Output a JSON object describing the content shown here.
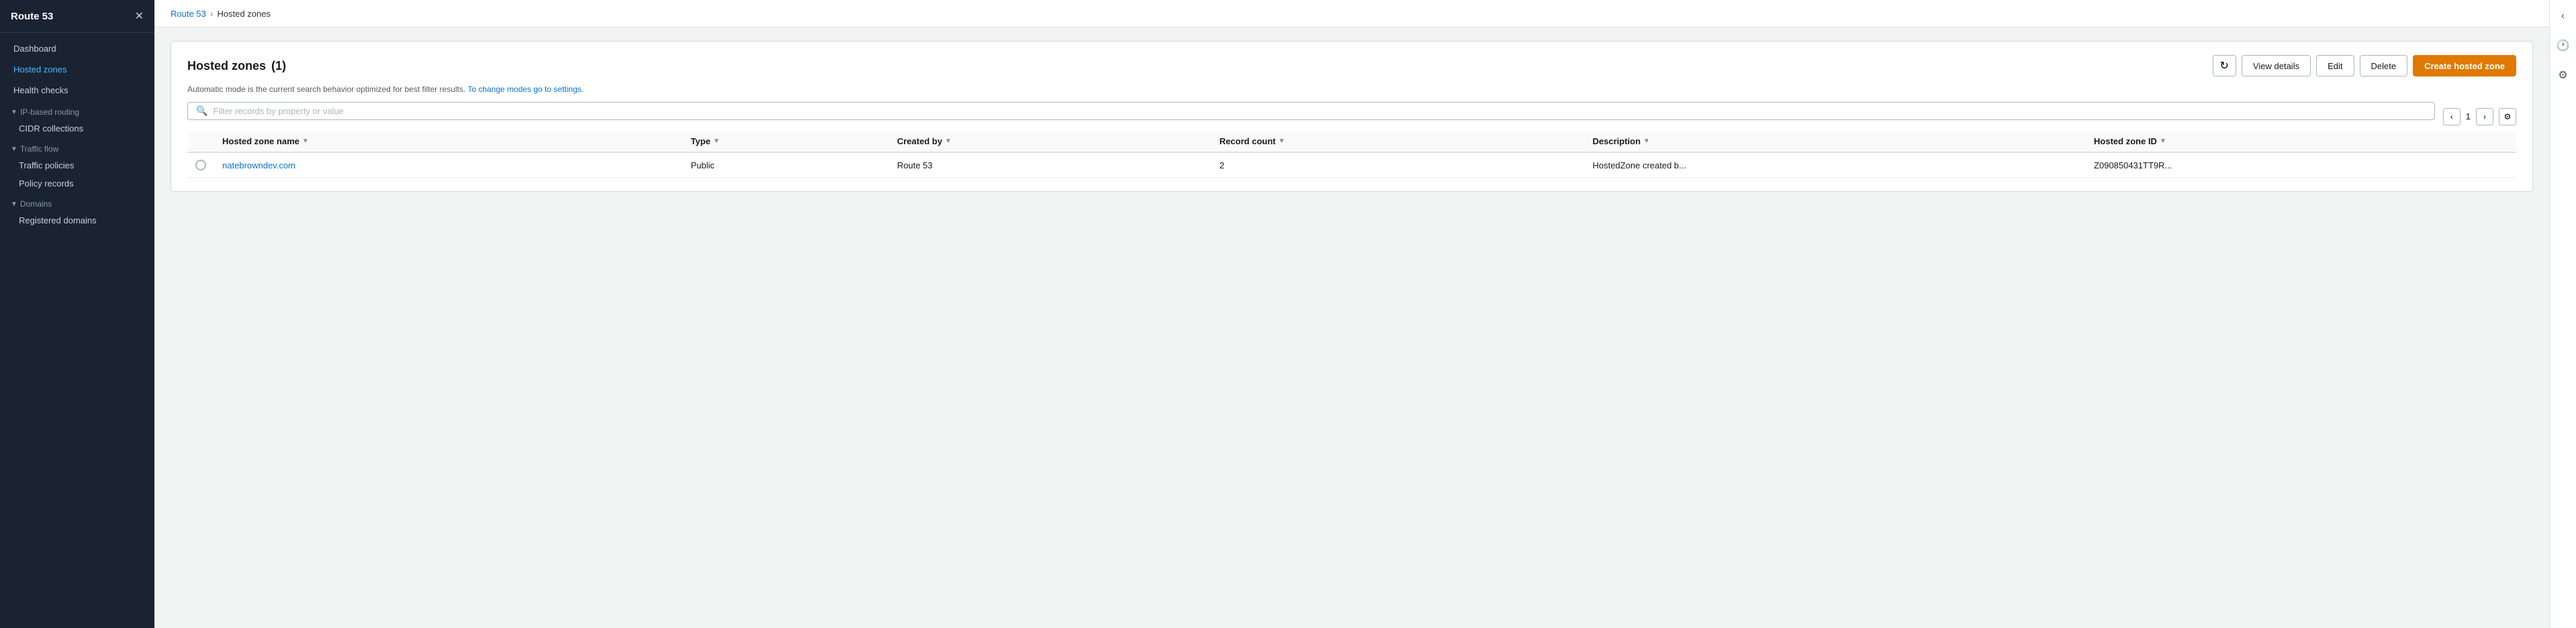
{
  "sidebar": {
    "title": "Route 53",
    "items": [
      {
        "id": "dashboard",
        "label": "Dashboard",
        "type": "item"
      },
      {
        "id": "hosted-zones",
        "label": "Hosted zones",
        "type": "item",
        "active": true
      },
      {
        "id": "health-checks",
        "label": "Health checks",
        "type": "item"
      },
      {
        "id": "ip-based-routing",
        "label": "IP-based routing",
        "type": "section"
      },
      {
        "id": "cidr-collections",
        "label": "CIDR collections",
        "type": "sub"
      },
      {
        "id": "traffic-flow",
        "label": "Traffic flow",
        "type": "section"
      },
      {
        "id": "traffic-policies",
        "label": "Traffic policies",
        "type": "sub"
      },
      {
        "id": "policy-records",
        "label": "Policy records",
        "type": "sub"
      },
      {
        "id": "domains",
        "label": "Domains",
        "type": "section"
      },
      {
        "id": "registered-domains",
        "label": "Registered domains",
        "type": "sub"
      }
    ]
  },
  "breadcrumb": {
    "link_label": "Route 53",
    "separator": "›",
    "current": "Hosted zones"
  },
  "main": {
    "title": "Hosted zones",
    "count": "(1)",
    "info_text": "Automatic mode is the current search behavior optimized for best filter results.",
    "info_link": "To change modes go to settings.",
    "search_placeholder": "Filter records by property or value",
    "page_number": "1",
    "buttons": {
      "refresh": "↻",
      "view_details": "View details",
      "edit": "Edit",
      "delete": "Delete",
      "create": "Create hosted zone"
    },
    "table": {
      "columns": [
        {
          "id": "select",
          "label": ""
        },
        {
          "id": "name",
          "label": "Hosted zone name"
        },
        {
          "id": "type",
          "label": "Type"
        },
        {
          "id": "created_by",
          "label": "Created by"
        },
        {
          "id": "record_count",
          "label": "Record count"
        },
        {
          "id": "description",
          "label": "Description"
        },
        {
          "id": "hosted_zone_id",
          "label": "Hosted zone ID"
        }
      ],
      "rows": [
        {
          "name": "natebrowndev.com",
          "type": "Public",
          "created_by": "Route 53",
          "record_count": "2",
          "description": "HostedZone created b...",
          "hosted_zone_id": "Z090850431TT9R..."
        }
      ]
    }
  },
  "right_panel": {
    "icons": [
      "clock",
      "settings"
    ]
  }
}
